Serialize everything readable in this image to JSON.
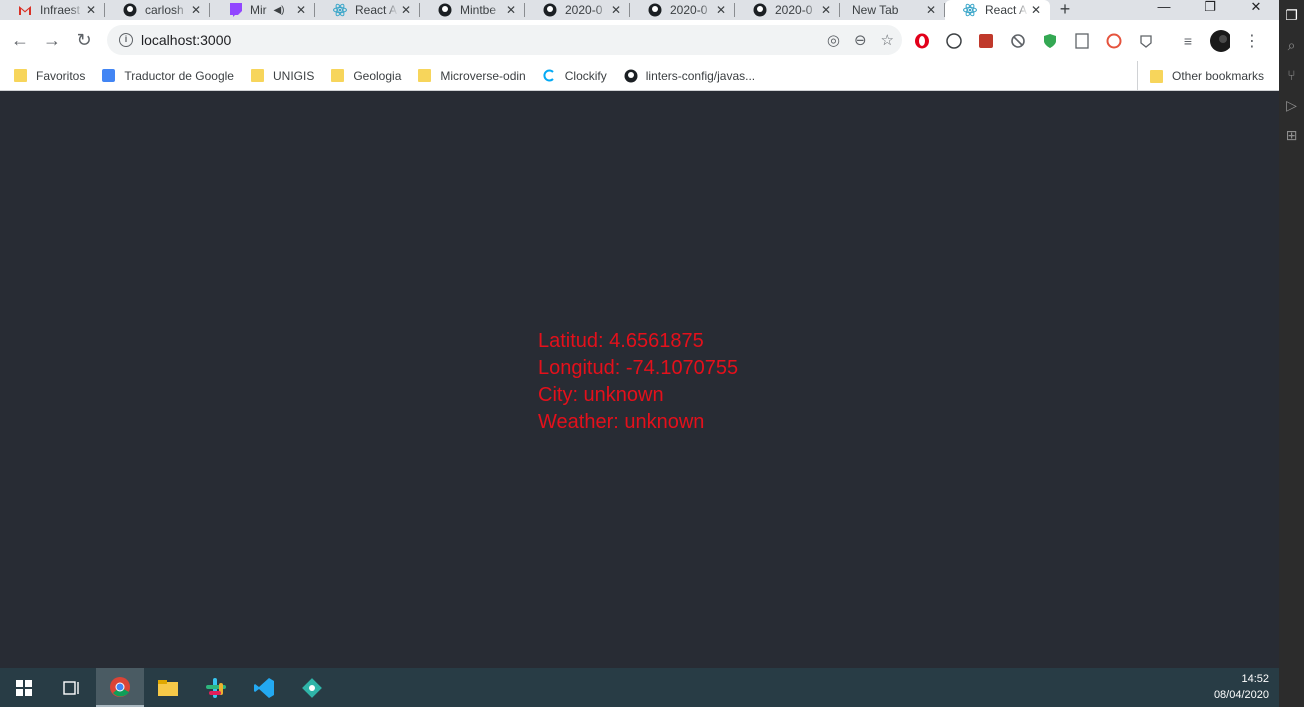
{
  "tabs": [
    {
      "title": "Infraest",
      "icon": "gmail-icon"
    },
    {
      "title": "carlosh",
      "icon": "github-icon"
    },
    {
      "title": "Mir",
      "icon": "twitch-icon"
    },
    {
      "title": "React A",
      "icon": "react-icon"
    },
    {
      "title": "Mintbe",
      "icon": "github-icon"
    },
    {
      "title": "2020-0",
      "icon": "github-icon"
    },
    {
      "title": "2020-0",
      "icon": "github-icon"
    },
    {
      "title": "2020-0",
      "icon": "github-icon"
    },
    {
      "title": "New Tab",
      "icon": ""
    },
    {
      "title": "React A",
      "icon": "react-icon"
    }
  ],
  "toolbar": {
    "url": "localhost:3000"
  },
  "bookmarks": {
    "items": [
      "Favoritos",
      "Traductor de Google",
      "UNIGIS",
      "Geologia",
      "Microverse-odin",
      "Clockify",
      "linters-config/javas..."
    ],
    "other": "Other bookmarks"
  },
  "weather": {
    "latitude": "Latitud: 4.6561875",
    "longitude": "Longitud: -74.1070755",
    "city": "City: unknown",
    "weather": "Weather: unknown"
  },
  "clock": {
    "time": "14:52",
    "date": "08/04/2020"
  },
  "colors": {
    "page_bg": "#282c34",
    "text": "#e4101b"
  }
}
